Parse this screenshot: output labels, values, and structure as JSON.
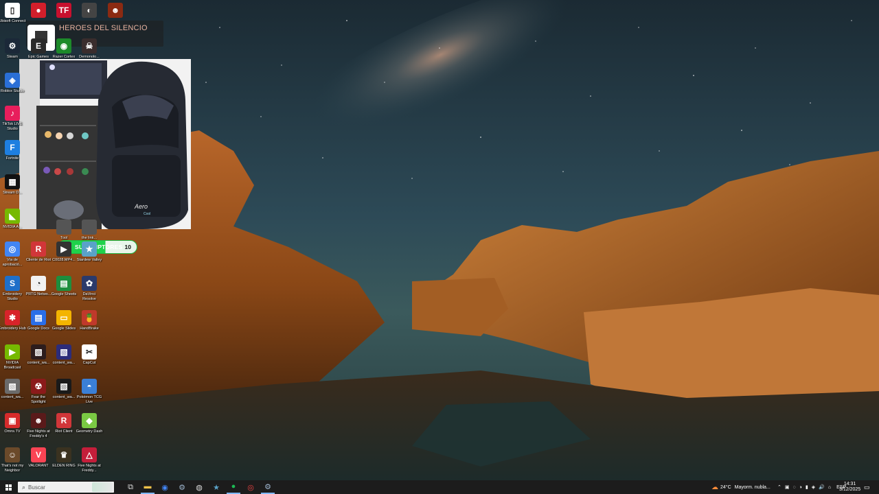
{
  "desktop": {
    "song_title": "HEROES DEL SILENCIO",
    "icons": [
      {
        "label": "Ubisoft Connect",
        "color": "#ffffff",
        "glyph": "▯"
      },
      {
        "label": "",
        "color": "#d21f2b",
        "glyph": "●"
      },
      {
        "label": "",
        "color": "#c8102e",
        "glyph": "TF"
      },
      {
        "label": "",
        "color": "#444444",
        "glyph": "◐"
      },
      {
        "label": "",
        "color": "#8b2a12",
        "glyph": "☻"
      },
      {
        "label": "Steam",
        "color": "#1b2838",
        "glyph": "⚙"
      },
      {
        "label": "Epic Games",
        "color": "#2a2a2a",
        "glyph": "E"
      },
      {
        "label": "Razer Cortex",
        "color": "#1d8a2a",
        "glyph": "◉"
      },
      {
        "label": "Demonolo...",
        "color": "#3a2d2d",
        "glyph": "☠"
      },
      {
        "label": "Roblox Studio",
        "color": "#2a6fd6",
        "glyph": "◈"
      },
      {
        "label": "TikTok LIVE Studio",
        "color": "#e81e5c",
        "glyph": "♪"
      },
      {
        "label": "Fortnite",
        "color": "#1e7fe0",
        "glyph": "F"
      },
      {
        "label": "Stream D...",
        "color": "#111111",
        "glyph": "▦"
      },
      {
        "label": "NVIDIA A...",
        "color": "#76b900",
        "glyph": "◣"
      },
      {
        "label": "Tool",
        "color": "#555555",
        "glyph": ""
      },
      {
        "label": "the link...",
        "color": "#555555",
        "glyph": ""
      },
      {
        "label": "Vía de aprobació...",
        "color": "#4285f4",
        "glyph": "◎"
      },
      {
        "label": "Cliente de Riot",
        "color": "#d13639",
        "glyph": "R"
      },
      {
        "label": "C0028.MP4...",
        "color": "#333333",
        "glyph": "▶"
      },
      {
        "label": "Stardew Valley",
        "color": "#5aa2c8",
        "glyph": "★"
      },
      {
        "label": "Embroidery Studio",
        "color": "#1f6fc9",
        "glyph": "S"
      },
      {
        "label": "PRTG Netwo...",
        "color": "#f2f2f2",
        "glyph": "◔"
      },
      {
        "label": "Google Sheets",
        "color": "#1e8e3e",
        "glyph": "▤"
      },
      {
        "label": "DaVinci Resolve",
        "color": "#2b3a6b",
        "glyph": "✿"
      },
      {
        "label": "Embroidery Hub",
        "color": "#d8232a",
        "glyph": "✱"
      },
      {
        "label": "Google Docs",
        "color": "#2a6ee8",
        "glyph": "▤"
      },
      {
        "label": "Google Slides",
        "color": "#f4b400",
        "glyph": "▭"
      },
      {
        "label": "HandBrake",
        "color": "#c0392b",
        "glyph": "🍍"
      },
      {
        "label": "NVIDIA Broadcast",
        "color": "#76b900",
        "glyph": "▶"
      },
      {
        "label": "content_wa...",
        "color": "#2d1d1d",
        "glyph": "▧"
      },
      {
        "label": "content_wa...",
        "color": "#2c2c7a",
        "glyph": "▧"
      },
      {
        "label": "CapCut",
        "color": "#ffffff",
        "glyph": "✂"
      },
      {
        "label": "content_wa...",
        "color": "#6b6b6b",
        "glyph": "▧"
      },
      {
        "label": "Fear the Spotlight",
        "color": "#8b1a1a",
        "glyph": "☢"
      },
      {
        "label": "content_wa...",
        "color": "#1a1a1a",
        "glyph": "▧"
      },
      {
        "label": "Pokémon TCG Live",
        "color": "#3b7fd6",
        "glyph": "◓"
      },
      {
        "label": "Omns.TV",
        "color": "#d62b2b",
        "glyph": "▣"
      },
      {
        "label": "Five Nights at Freddy's 4",
        "color": "#5a1a1a",
        "glyph": "☻"
      },
      {
        "label": "Riot Client",
        "color": "#d13639",
        "glyph": "R"
      },
      {
        "label": "Geometry Dash",
        "color": "#7ac943",
        "glyph": "◆"
      },
      {
        "label": "That's not my Neighbor",
        "color": "#6b4a2a",
        "glyph": "☺"
      },
      {
        "label": "VALORANT",
        "color": "#fa4454",
        "glyph": "V"
      },
      {
        "label": "ELDEN RING",
        "color": "#3a3220",
        "glyph": "♛"
      },
      {
        "label": "Five Nights at Freddy...",
        "color": "#c41e3a",
        "glyph": "△"
      }
    ]
  },
  "overlay": {
    "subs_label": "SUSCRIPTORES",
    "subs_count": "10",
    "chair_brand": "Aero",
    "chair_sub": "Cool"
  },
  "taskbar": {
    "search_placeholder": "Buscar",
    "apps": [
      {
        "name": "task-view",
        "glyph": "⧉",
        "color": "#dddddd"
      },
      {
        "name": "file-explorer",
        "glyph": "▬",
        "color": "#f2c24a"
      },
      {
        "name": "chrome",
        "glyph": "◉",
        "color": "#4285f4"
      },
      {
        "name": "steam",
        "glyph": "⚙",
        "color": "#9fb7d0"
      },
      {
        "name": "obs",
        "glyph": "◍",
        "color": "#dddddd"
      },
      {
        "name": "stardew",
        "glyph": "★",
        "color": "#5aa2c8"
      },
      {
        "name": "spotify",
        "glyph": "●",
        "color": "#1db954"
      },
      {
        "name": "riot",
        "glyph": "◎",
        "color": "#e84141"
      },
      {
        "name": "steam-active",
        "glyph": "⚙",
        "color": "#9fb7d0"
      }
    ],
    "weather_temp": "24°C",
    "weather_text": "Mayorm. nubla...",
    "language": "ESP",
    "time": "14:31",
    "date": "3/12/2025"
  }
}
